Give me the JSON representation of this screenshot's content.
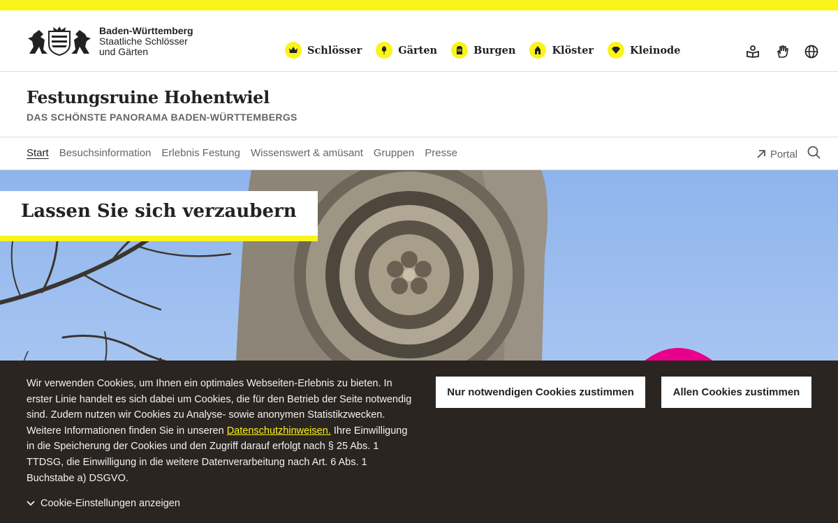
{
  "logo": {
    "line1": "Baden-Württemberg",
    "line2": "Staatliche Schlösser",
    "line3": "und Gärten"
  },
  "portal_nav": [
    {
      "label": "Schlösser",
      "icon": "crown-icon"
    },
    {
      "label": "Gärten",
      "icon": "flower-icon"
    },
    {
      "label": "Burgen",
      "icon": "helmet-icon"
    },
    {
      "label": "Klöster",
      "icon": "church-icon"
    },
    {
      "label": "Kleinode",
      "icon": "diamond-icon"
    }
  ],
  "utility_icons": [
    "book-icon",
    "sign-language-icon",
    "globe-icon"
  ],
  "site": {
    "title": "Festungsruine Hohentwiel",
    "subtitle": "DAS SCHÖNSTE PANORAMA BADEN-WÜRTTEMBERGS"
  },
  "main_nav": {
    "items": [
      "Start",
      "Besuchsinformation",
      "Erlebnis Festung",
      "Wissenswert & amüsant",
      "Gruppen",
      "Presse"
    ],
    "active": "Start",
    "portal_label": "Portal"
  },
  "hero": {
    "heading": "Lassen Sie sich verzaubern"
  },
  "cookie": {
    "text_before": "Wir verwenden Cookies, um Ihnen ein optimales Webseiten-Erlebnis zu bieten. In erster Linie handelt es sich dabei um Cookies, die für den Betrieb der Seite notwendig sind. Zudem nutzen wir Cookies zu Analyse- sowie anonymen Statistikzwecken. Weitere Informationen finden Sie in unseren ",
    "link_text": "Datenschutzhinweisen.",
    "text_after": " Ihre Einwilligung in die Speicherung der Cookies und den Zugriff darauf erfolgt nach § 25 Abs. 1 TTDSG, die Einwilligung in die weitere Datenverarbeitung nach Art. 6 Abs. 1 Buchstabe a) DSGVO.",
    "settings_label": "Cookie-Einstellungen anzeigen",
    "btn_necessary": "Nur notwendigen Cookies zustimmen",
    "btn_all": "Allen Cookies zustimmen"
  },
  "colors": {
    "accent": "#f9f41a",
    "cookie_bg": "#2a2521",
    "sky": "#9dbdf0",
    "badge_pink": "#e8008a"
  }
}
